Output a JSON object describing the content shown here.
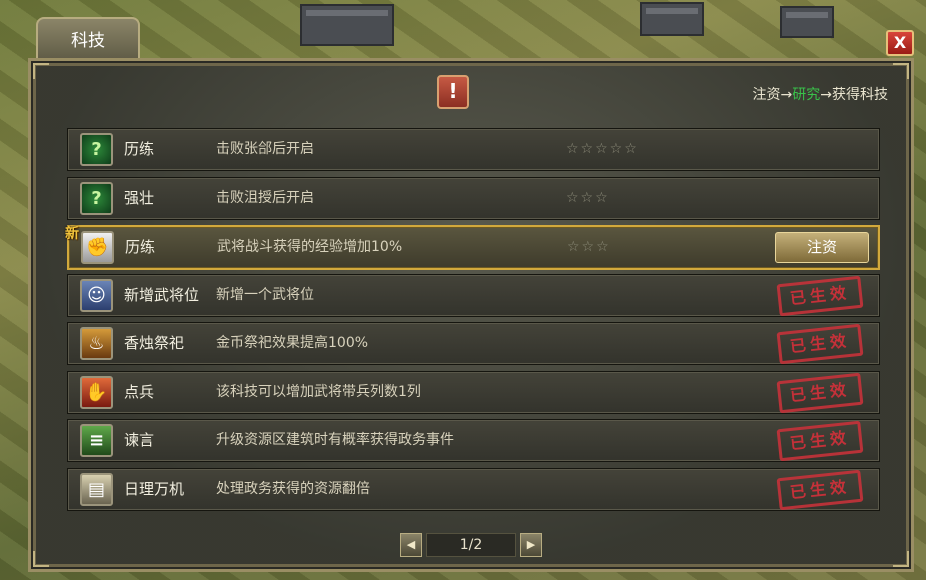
{
  "window": {
    "tab_label": "科技",
    "close_label": "X"
  },
  "flow": {
    "step1": "注资",
    "arrow": "→",
    "step2": "研究",
    "step3": "获得科技"
  },
  "alert_icon": "!",
  "rows": [
    {
      "icon": "question-icon",
      "icon_glyph": "?",
      "name": "历练",
      "desc": "击败张郃后开启",
      "stars": "☆☆☆☆☆",
      "state": "locked"
    },
    {
      "icon": "question-icon",
      "icon_glyph": "?",
      "name": "强壮",
      "desc": "击败沮授后开启",
      "stars": "☆☆☆",
      "state": "locked"
    },
    {
      "icon": "fist-icon",
      "icon_glyph": "✊",
      "badge": "新",
      "name": "历练",
      "desc": "武将战斗获得的经验增加10%",
      "stars": "☆☆☆",
      "state": "invest",
      "action_label": "注资"
    },
    {
      "icon": "general-portrait-icon",
      "icon_glyph": "☺",
      "name": "新增武将位",
      "desc": "新增一个武将位",
      "stamp": "已生效",
      "state": "active"
    },
    {
      "icon": "incense-altar-icon",
      "icon_glyph": "♨",
      "name": "香烛祭祀",
      "desc": "金币祭祀效果提高100%",
      "stamp": "已生效",
      "state": "active"
    },
    {
      "icon": "raised-fist-icon",
      "icon_glyph": "✋",
      "name": "点兵",
      "desc": "该科技可以增加武将带兵列数1列",
      "stamp": "已生效",
      "state": "active"
    },
    {
      "icon": "scroll-icon",
      "icon_glyph": "≡",
      "name": "谏言",
      "desc": "升级资源区建筑时有概率获得政务事件",
      "stamp": "已生效",
      "state": "active"
    },
    {
      "icon": "document-icon",
      "icon_glyph": "▤",
      "name": "日理万机",
      "desc": "处理政务获得的资源翻倍",
      "stamp": "已生效",
      "state": "active"
    }
  ],
  "pager": {
    "prev": "◀",
    "page": "1/2",
    "next": "▶"
  },
  "colors": {
    "accent": "#d2a93c",
    "stamp": "#c6323a",
    "highlight": "#39c24a"
  }
}
